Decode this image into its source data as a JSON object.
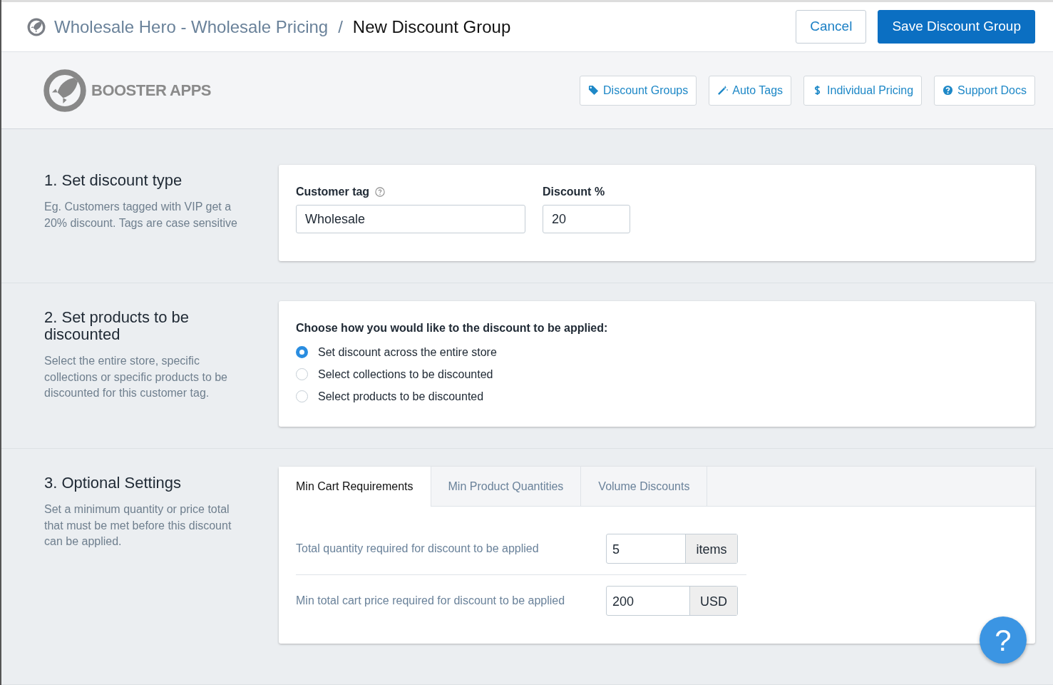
{
  "top_bar": {
    "app_title": "Wholesale Hero - Wholesale Pricing",
    "separator": "/",
    "page_title": "New Discount Group",
    "buttons": [
      {
        "label": "Cancel",
        "kind": "secondary"
      },
      {
        "label": "Save Discount Group",
        "kind": "primary"
      }
    ]
  },
  "header": {
    "logo_text": "BOOSTER APPS",
    "nav_buttons": [
      {
        "label": "Discount Groups"
      },
      {
        "label": "Auto Tags"
      },
      {
        "label": "Individual Pricing"
      },
      {
        "label": "Support Docs"
      }
    ]
  },
  "sections": [
    {
      "kind": "fields",
      "title": "1. Set discount type",
      "description": "Eg. Customers tagged with VIP get a 20% discount. Tags are case sensitive",
      "fields": [
        {
          "label": "Customer tag",
          "has_help": true,
          "value": "Wholesale"
        },
        {
          "label": "Discount %",
          "has_help": false,
          "value": "20"
        }
      ]
    },
    {
      "kind": "radios",
      "title": "2. Set products to be discounted",
      "description": "Select the entire store, specific collections or specific products to be discounted for this customer tag.",
      "question": "Choose how you would like to the discount to be applied:",
      "options": [
        {
          "label": "Set discount across the entire store",
          "selected": true
        },
        {
          "label": "Select collections to be discounted",
          "selected": false
        },
        {
          "label": "Select products to be discounted",
          "selected": false
        }
      ]
    },
    {
      "kind": "tabs",
      "title": "3. Optional Settings",
      "description": "Set a minimum quantity or price total that must be met before this discount can be applied.",
      "tabs": [
        {
          "label": "Min Cart Requirements",
          "selected": true
        },
        {
          "label": "Min Product Quantities",
          "selected": false
        },
        {
          "label": "Volume Discounts",
          "selected": false
        }
      ],
      "requirements": [
        {
          "label": "Total quantity required for discount to be applied",
          "value": "5",
          "unit": "items"
        },
        {
          "label": "Min total cart price required for discount to be applied",
          "value": "200",
          "unit": "USD"
        }
      ]
    }
  ],
  "help_button": {
    "label": "?"
  }
}
